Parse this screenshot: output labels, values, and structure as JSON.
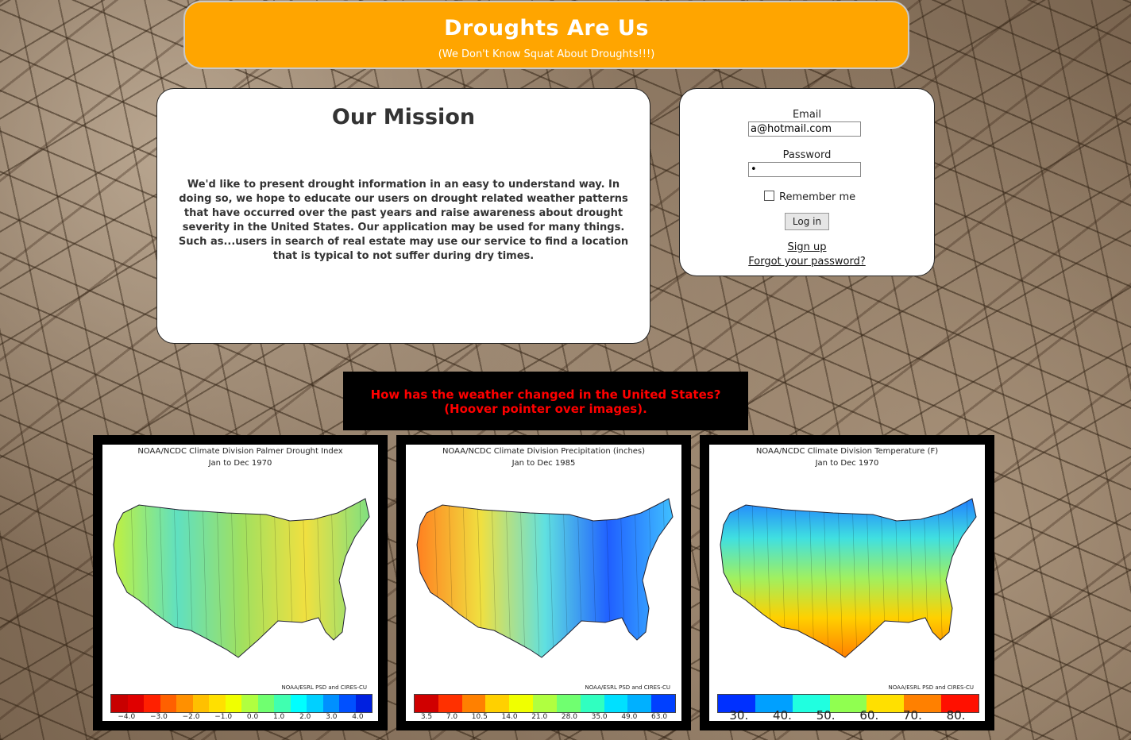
{
  "header": {
    "title": "Droughts Are Us",
    "subtitle": "(We Don't Know Squat About Droughts!!!)"
  },
  "mission": {
    "title": "Our Mission",
    "text": "We'd like to present drought information in an easy to understand way. In doing so, we hope to educate our users on drought related weather patterns that have occurred over the past years and raise awareness about drought severity in the United States. Our application may be used for many things. Such as...users in search of real estate may use our service to find a location that is typical to not suffer during dry times."
  },
  "login": {
    "email_label": "Email",
    "email_value": "a@hotmail.com",
    "password_label": "Password",
    "password_value": "•",
    "remember_label": "Remember me",
    "remember_checked": false,
    "login_button": "Log in",
    "signup_link": "Sign up",
    "forgot_link": "Forgot your password?"
  },
  "question": {
    "line1": "How has the weather changed in the United States?",
    "line2": "(Hoover pointer over images)."
  },
  "maps": [
    {
      "title": "NOAA/NCDC Climate Division Palmer Drought Index",
      "subtitle": "Jan to Dec 1970",
      "credit": "NOAA/ESRL PSD and CIRES-CU",
      "colors": [
        "#c80000",
        "#e00000",
        "#ff2000",
        "#ff6000",
        "#ff9000",
        "#ffc000",
        "#ffe000",
        "#f0ff00",
        "#b0ff40",
        "#70ff70",
        "#40ffb0",
        "#00ffff",
        "#00d0ff",
        "#0090ff",
        "#0050ff",
        "#0020e0"
      ],
      "ticks": [
        "−4.0",
        "−3.0",
        "−2.0",
        "−1.0",
        "0.0",
        "1.0",
        "2.0",
        "3.0",
        "4.0"
      ],
      "fill": "#a0e060"
    },
    {
      "title": "NOAA/NCDC Climate Division Precipitation (inches)",
      "subtitle": "Jan to Dec 1985",
      "credit": "NOAA/ESRL PSD and CIRES-CU",
      "colors": [
        "#d00000",
        "#ff3000",
        "#ff8000",
        "#ffd000",
        "#f0ff00",
        "#b0ff40",
        "#70ff70",
        "#30ffc0",
        "#00e0ff",
        "#00b0ff",
        "#0040ff"
      ],
      "ticks": [
        "3.5",
        "7.0",
        "10.5",
        "14.0",
        "21.0",
        "28.0",
        "35.0",
        "49.0",
        "63.0"
      ],
      "fill": "#40d0e0"
    },
    {
      "title": "NOAA/NCDC Climate Division Temperature (F)",
      "subtitle": "Jan to Dec 1970",
      "credit": "NOAA/ESRL PSD and CIRES-CU",
      "colors": [
        "#0030ff",
        "#00a0ff",
        "#20ffe0",
        "#90ff50",
        "#ffe000",
        "#ff8000",
        "#ff1000"
      ],
      "ticks": [
        "30.",
        "40.",
        "50.",
        "60.",
        "70.",
        "80."
      ],
      "fill": "#60e8a0"
    }
  ]
}
